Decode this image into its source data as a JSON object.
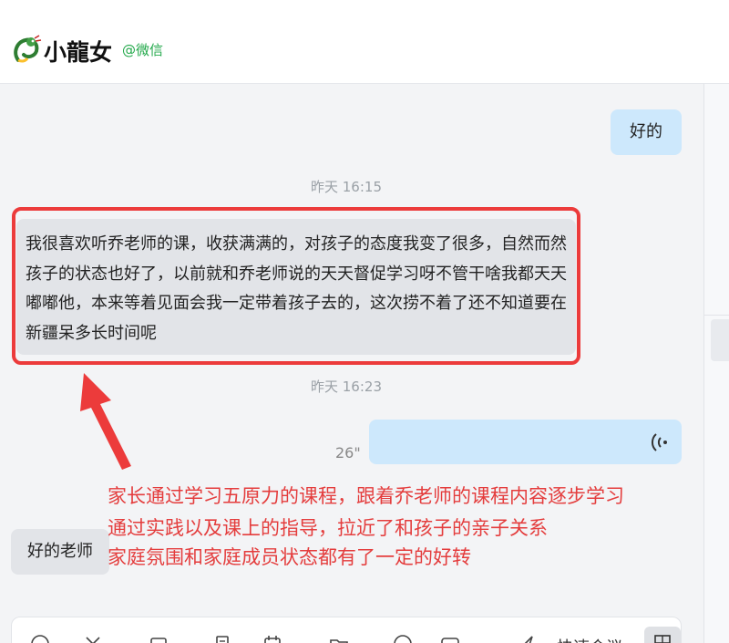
{
  "header": {
    "contact_name": "小龍女",
    "contact_source": "@微信",
    "logo_icon": "dragon-logo-icon"
  },
  "messages": [
    {
      "direction": "out",
      "text": "好的"
    },
    {
      "type": "time",
      "text": "昨天 16:15"
    },
    {
      "direction": "in",
      "text": "我很喜欢听乔老师的课，收获满满的，对孩子的态度我变了很多，自然而然孩子的状态也好了，以前就和乔老师说的天天督促学习呀不管干啥我都天天嘟嘟他，本来等着见面会我一定带着孩子去的，这次捞不着了还不知道要在新疆呆多长时间呢"
    },
    {
      "type": "time",
      "text": "昨天 16:23"
    },
    {
      "direction": "out",
      "type": "voice",
      "duration": "26\""
    },
    {
      "direction": "in",
      "text": "好的老师"
    }
  ],
  "annotation": {
    "lines": [
      "家长通过学习五原力的课程，跟着乔老师的课程内容逐步学习",
      "通过实践以及课上的指导，拉近了和孩子的亲子关系",
      "家庭氛围和家庭成员状态都有了一定的好转"
    ],
    "color": "#e43d3d"
  },
  "toolbar": {
    "quick_meeting_label": "快速会议"
  },
  "colors": {
    "outgoing_bubble": "#cde8fc",
    "incoming_bubble": "#e2e4e8",
    "source_green": "#22a84a"
  }
}
